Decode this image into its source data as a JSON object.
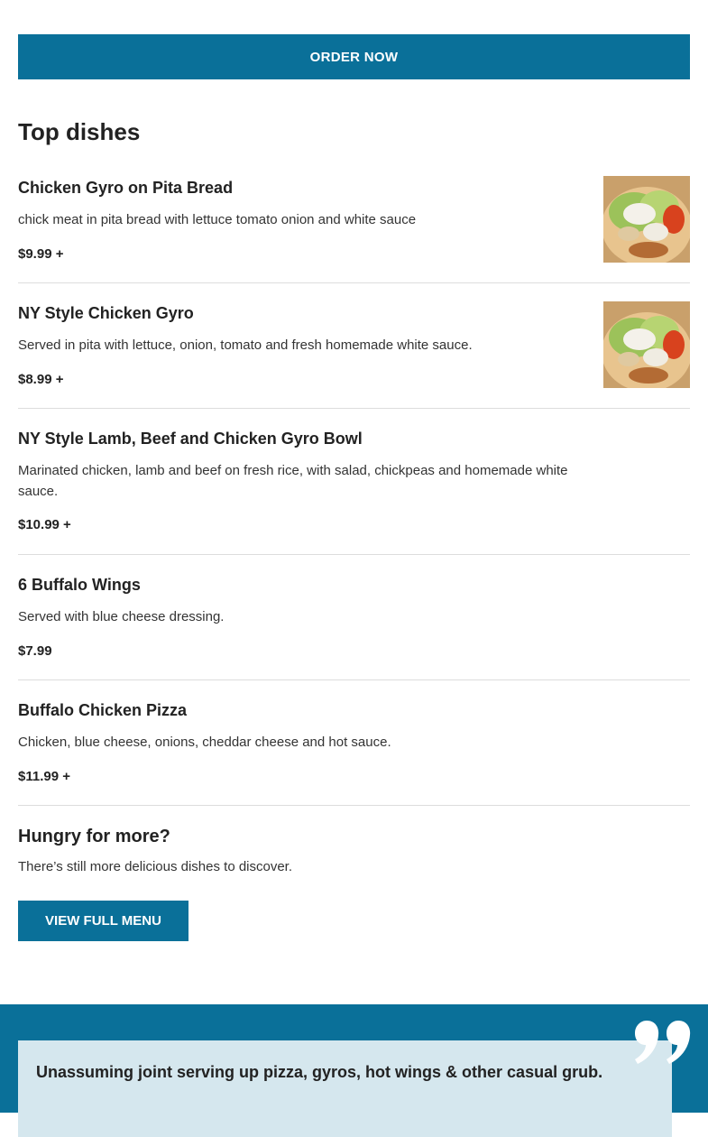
{
  "order_button": {
    "label": "ORDER NOW"
  },
  "top_dishes": {
    "title": "Top dishes",
    "items": [
      {
        "name": "Chicken Gyro on Pita Bread",
        "description": "chick meat in pita bread with lettuce tomato onion and white sauce",
        "price": "$9.99 +",
        "image": "gyro-photo"
      },
      {
        "name": "NY Style Chicken Gyro",
        "description": "Served in pita with lettuce, onion, tomato and fresh homemade white sauce.",
        "price": "$8.99 +",
        "image": "gyro-photo"
      },
      {
        "name": "NY Style Lamb, Beef and Chicken Gyro Bowl",
        "description": "Marinated chicken, lamb and beef on fresh rice, with salad, chickpeas and homemade white sauce.",
        "price": "$10.99 +"
      },
      {
        "name": "6 Buffalo Wings",
        "description": "Served with blue cheese dressing.",
        "price": "$7.99"
      },
      {
        "name": "Buffalo Chicken Pizza",
        "description": "Chicken, blue cheese, onions, cheddar cheese and hot sauce.",
        "price": "$11.99 +"
      }
    ]
  },
  "more": {
    "title": "Hungry for more?",
    "text": "There’s still more delicious dishes to discover.",
    "button_label": "VIEW FULL MENU"
  },
  "review": {
    "quote_icon": "quote-icon",
    "text": "Unassuming joint serving up pizza, gyros, hot wings & other casual grub."
  },
  "colors": {
    "accent": "#0a7099",
    "review_card": "#d5e7ee",
    "divider": "#dddddd"
  }
}
